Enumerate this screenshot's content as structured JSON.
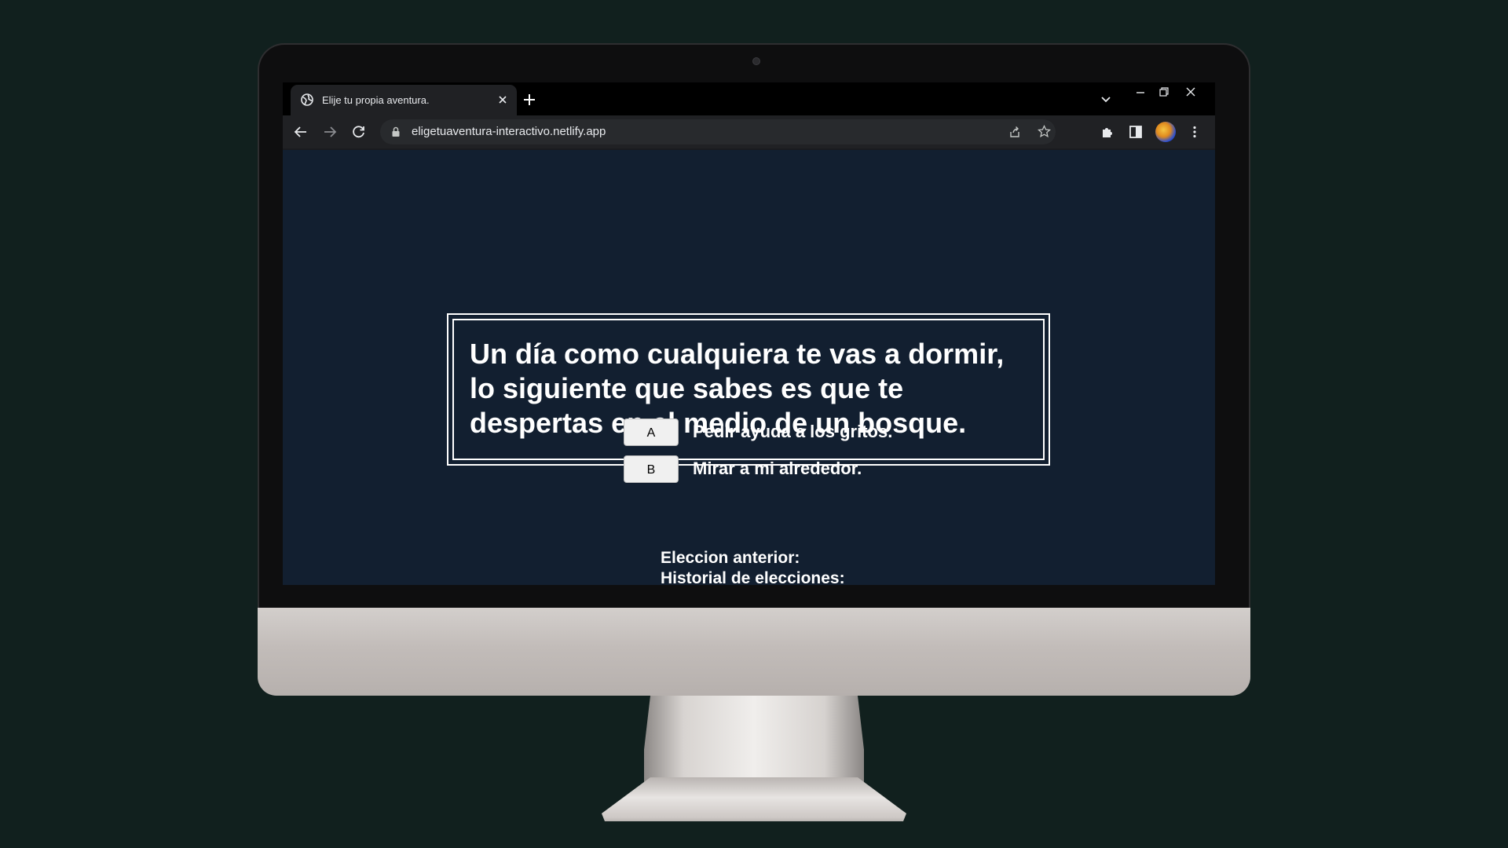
{
  "browser": {
    "tab": {
      "title": "Elije tu propia aventura.",
      "favicon": "globe-icon"
    },
    "omnibox": {
      "url": "eligetuaventura-interactivo.netlify.app"
    },
    "icons": [
      "back-arrow-icon",
      "forward-arrow-icon",
      "reload-icon",
      "lock-icon",
      "share-icon",
      "star-icon",
      "puzzle-icon",
      "side-panel-icon",
      "avatar",
      "more-vert-icon"
    ]
  },
  "story": {
    "text": "Un día como cualquiera te vas a dormir, lo siguiente que sabes es que te despertas en el medio de un bosque."
  },
  "choices": [
    {
      "button": "A",
      "label": "Pedir ayuda a los gritos."
    },
    {
      "button": "B",
      "label": "Mirar a mi alrededor."
    }
  ],
  "history": {
    "previous_label": "Eleccion anterior:",
    "history_label": "Historial de elecciones:"
  },
  "colors": {
    "background": "#11201e",
    "page_bg": "#121f30",
    "text": "#ffffff",
    "button_bg": "#f0f0f0"
  }
}
